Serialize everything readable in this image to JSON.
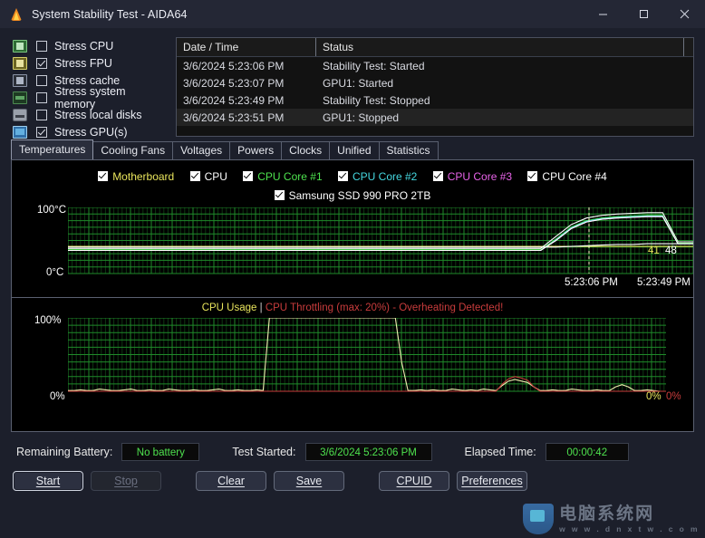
{
  "window": {
    "title": "System Stability Test - AIDA64",
    "icon": "flame-icon",
    "minimize": "–",
    "maximize": "□",
    "close": "✕"
  },
  "stress_options": [
    {
      "label": "Stress CPU",
      "checked": false,
      "icon": "cpu-chip-icon"
    },
    {
      "label": "Stress FPU",
      "checked": true,
      "icon": "fpu-chip-icon"
    },
    {
      "label": "Stress cache",
      "checked": false,
      "icon": "cache-chip-icon"
    },
    {
      "label": "Stress system memory",
      "checked": false,
      "icon": "memory-module-icon"
    },
    {
      "label": "Stress local disks",
      "checked": false,
      "icon": "disk-drive-icon"
    },
    {
      "label": "Stress GPU(s)",
      "checked": true,
      "icon": "gpu-display-icon"
    }
  ],
  "log": {
    "columns": [
      "Date / Time",
      "Status"
    ],
    "rows": [
      {
        "datetime": "3/6/2024 5:23:06 PM",
        "status": "Stability Test: Started"
      },
      {
        "datetime": "3/6/2024 5:23:07 PM",
        "status": "GPU1: Started"
      },
      {
        "datetime": "3/6/2024 5:23:49 PM",
        "status": "Stability Test: Stopped"
      },
      {
        "datetime": "3/6/2024 5:23:51 PM",
        "status": "GPU1: Stopped"
      }
    ]
  },
  "tabs": [
    {
      "label": "Temperatures",
      "active": true
    },
    {
      "label": "Cooling Fans",
      "active": false
    },
    {
      "label": "Voltages",
      "active": false
    },
    {
      "label": "Powers",
      "active": false
    },
    {
      "label": "Clocks",
      "active": false
    },
    {
      "label": "Unified",
      "active": false
    },
    {
      "label": "Statistics",
      "active": false
    }
  ],
  "legend": {
    "row1": [
      {
        "label": "Motherboard",
        "color": "#e8e45c",
        "checked": true
      },
      {
        "label": "CPU",
        "color": "#ffffff",
        "checked": true
      },
      {
        "label": "CPU Core #1",
        "color": "#4ee24e",
        "checked": true
      },
      {
        "label": "CPU Core #2",
        "color": "#45d8e0",
        "checked": true
      },
      {
        "label": "CPU Core #3",
        "color": "#e863e8",
        "checked": true
      },
      {
        "label": "CPU Core #4",
        "color": "#ffffff",
        "checked": true
      }
    ],
    "row2": [
      {
        "label": "Samsung SSD 990 PRO 2TB",
        "color": "#ffffff",
        "checked": true
      }
    ]
  },
  "chart_data": [
    {
      "type": "line",
      "name": "temperatures",
      "title": "",
      "ylabel": "",
      "ytick_labels": [
        "100°C",
        "0°C"
      ],
      "ylim": [
        0,
        100
      ],
      "xtick_labels": [
        "5:23:06 PM",
        "5:23:49 PM"
      ],
      "grid": true,
      "grid_color": "#1f8a2a",
      "background": "#000000",
      "value_labels": [
        {
          "text": "41",
          "color": "#e8e45c"
        },
        {
          "text": "48",
          "color": "#ffffff"
        }
      ],
      "series": [
        {
          "name": "Motherboard",
          "color": "#e8e45c",
          "values": [
            41,
            41,
            41,
            41,
            41,
            41,
            41,
            41,
            41,
            41,
            41,
            41,
            41,
            41,
            41,
            41,
            41,
            41,
            41,
            41,
            41,
            41,
            41,
            41,
            41,
            41,
            41,
            41,
            41,
            41,
            41,
            41,
            41,
            41,
            41,
            41,
            41,
            41,
            41,
            41,
            41,
            41
          ]
        },
        {
          "name": "CPU",
          "color": "#ffffff",
          "values": [
            38,
            38,
            38,
            38,
            38,
            38,
            38,
            38,
            38,
            38,
            38,
            38,
            38,
            38,
            38,
            38,
            38,
            38,
            38,
            38,
            38,
            38,
            38,
            38,
            38,
            38,
            38,
            38,
            38,
            38,
            38,
            38,
            56,
            74,
            84,
            88,
            90,
            91,
            92,
            92,
            48,
            48
          ]
        },
        {
          "name": "CPU Core #1",
          "color": "#4ee24e",
          "values": [
            36,
            36,
            36,
            36,
            36,
            36,
            36,
            36,
            36,
            36,
            36,
            36,
            36,
            36,
            36,
            36,
            36,
            36,
            36,
            36,
            36,
            36,
            36,
            36,
            36,
            36,
            36,
            36,
            36,
            36,
            36,
            36,
            52,
            70,
            80,
            84,
            86,
            87,
            88,
            88,
            46,
            46
          ]
        },
        {
          "name": "CPU Core #2",
          "color": "#45d8e0",
          "values": [
            35,
            35,
            35,
            35,
            35,
            35,
            35,
            35,
            35,
            35,
            35,
            35,
            35,
            35,
            35,
            35,
            35,
            35,
            35,
            35,
            35,
            35,
            35,
            35,
            35,
            35,
            35,
            35,
            35,
            35,
            35,
            35,
            51,
            69,
            79,
            83,
            85,
            86,
            87,
            87,
            45,
            45
          ]
        },
        {
          "name": "CPU Core #3",
          "color": "#e863e8",
          "values": [
            35,
            35,
            35,
            35,
            35,
            35,
            35,
            35,
            35,
            35,
            35,
            35,
            35,
            35,
            35,
            35,
            35,
            35,
            35,
            35,
            35,
            35,
            35,
            35,
            35,
            35,
            35,
            35,
            35,
            35,
            35,
            35,
            50,
            68,
            78,
            82,
            84,
            85,
            86,
            86,
            45,
            45
          ]
        },
        {
          "name": "CPU Core #4",
          "color": "#ffffff",
          "values": [
            35,
            35,
            35,
            35,
            35,
            35,
            35,
            35,
            35,
            35,
            35,
            35,
            35,
            35,
            35,
            35,
            35,
            35,
            35,
            35,
            35,
            35,
            35,
            35,
            35,
            35,
            35,
            35,
            35,
            35,
            35,
            35,
            50,
            68,
            78,
            82,
            84,
            85,
            86,
            86,
            45,
            45
          ]
        },
        {
          "name": "Samsung SSD 990 PRO 2TB",
          "color": "#ffffff",
          "values": [
            40,
            40,
            40,
            40,
            40,
            40,
            40,
            40,
            40,
            40,
            40,
            40,
            40,
            40,
            40,
            40,
            40,
            40,
            40,
            40,
            40,
            40,
            40,
            40,
            40,
            40,
            40,
            40,
            40,
            40,
            40,
            40,
            40,
            41,
            42,
            43,
            44,
            44,
            45,
            45,
            45,
            45
          ]
        }
      ]
    },
    {
      "type": "line",
      "name": "cpu-usage",
      "title_parts": [
        {
          "text": "CPU Usage",
          "color": "#e8e45c"
        },
        {
          "text": "|",
          "color": "#cccccc"
        },
        {
          "text": "CPU Throttling (max: 20%) - Overheating Detected!",
          "color": "#c83c3c"
        }
      ],
      "ytick_labels": [
        "100%",
        "0%"
      ],
      "ylim": [
        0,
        100
      ],
      "grid": true,
      "grid_color": "#1f8a2a",
      "background": "#000000",
      "value_labels": [
        {
          "text": "0%",
          "color": "#e8e45c"
        },
        {
          "text": "0%",
          "color": "#c83c3c"
        }
      ],
      "series": [
        {
          "name": "CPU Usage",
          "color": "#f0eeb0",
          "values": [
            1,
            1,
            2,
            1,
            1,
            3,
            2,
            1,
            1,
            2,
            3,
            1,
            1,
            2,
            1,
            1,
            3,
            2,
            1,
            1,
            2,
            1,
            1,
            2,
            3,
            1,
            1,
            2,
            1,
            1,
            2,
            1,
            100,
            100,
            100,
            100,
            100,
            100,
            100,
            100,
            100,
            100,
            100,
            100,
            100,
            100,
            100,
            100,
            100,
            100,
            100,
            100,
            100,
            40,
            1,
            1,
            2,
            1,
            2,
            1,
            1,
            3,
            2,
            1,
            2,
            1,
            3,
            2,
            1,
            8,
            14,
            16,
            14,
            12,
            6,
            1,
            1,
            2,
            1,
            1,
            3,
            2,
            1,
            1,
            2,
            1,
            1,
            6,
            9,
            6,
            1,
            1,
            2,
            1,
            0,
            0
          ]
        },
        {
          "name": "CPU Throttling",
          "color": "#c83c3c",
          "values": [
            0,
            0,
            0,
            0,
            0,
            0,
            0,
            0,
            0,
            0,
            0,
            0,
            0,
            0,
            0,
            0,
            0,
            0,
            0,
            0,
            0,
            0,
            0,
            0,
            0,
            0,
            0,
            0,
            0,
            0,
            0,
            0,
            0,
            0,
            0,
            0,
            0,
            0,
            0,
            0,
            0,
            0,
            0,
            0,
            0,
            0,
            0,
            0,
            0,
            0,
            0,
            0,
            0,
            0,
            0,
            0,
            0,
            0,
            0,
            0,
            0,
            0,
            0,
            0,
            0,
            0,
            0,
            0,
            0,
            10,
            17,
            20,
            18,
            15,
            6,
            0,
            0,
            0,
            0,
            0,
            0,
            0,
            0,
            0,
            0,
            0,
            0,
            0,
            0,
            0,
            0,
            0,
            0,
            0,
            0,
            0
          ]
        }
      ]
    }
  ],
  "status": {
    "battery_label": "Remaining Battery:",
    "battery_value": "No battery",
    "started_label": "Test Started:",
    "started_value": "3/6/2024 5:23:06 PM",
    "elapsed_label": "Elapsed Time:",
    "elapsed_value": "00:00:42"
  },
  "buttons": [
    {
      "label": "Start",
      "state": "focused"
    },
    {
      "label": "Stop",
      "state": "disabled"
    },
    {
      "label": "Clear",
      "state": "normal"
    },
    {
      "label": "Save",
      "state": "normal"
    },
    {
      "label": "CPUID",
      "state": "normal"
    },
    {
      "label": "Preferences",
      "state": "normal"
    }
  ],
  "watermark": {
    "name": "电脑系统网",
    "url": "w w w . d n x t w . c o m"
  }
}
